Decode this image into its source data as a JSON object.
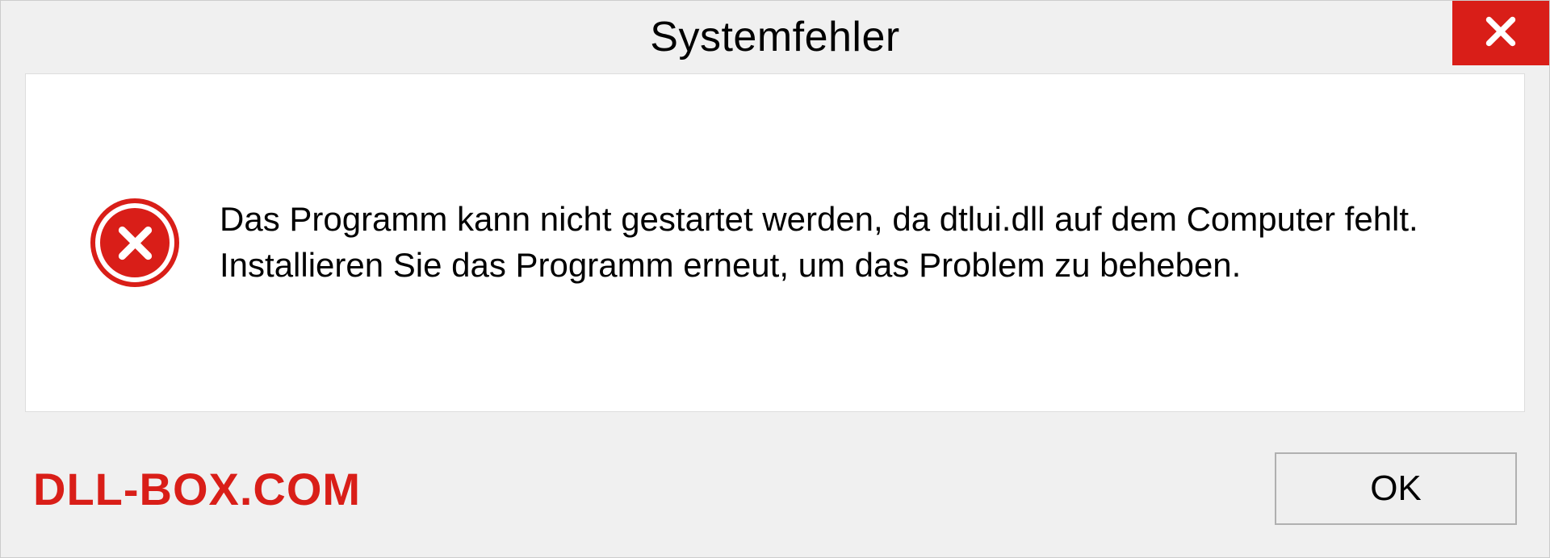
{
  "dialog": {
    "title": "Systemfehler",
    "message": "Das Programm kann nicht gestartet werden, da dtlui.dll auf dem Computer fehlt. Installieren Sie das Programm erneut, um das Problem zu beheben.",
    "ok_label": "OK"
  },
  "watermark": "DLL-BOX.COM",
  "colors": {
    "error_red": "#d91e18",
    "panel_bg": "#f0f0f0"
  }
}
